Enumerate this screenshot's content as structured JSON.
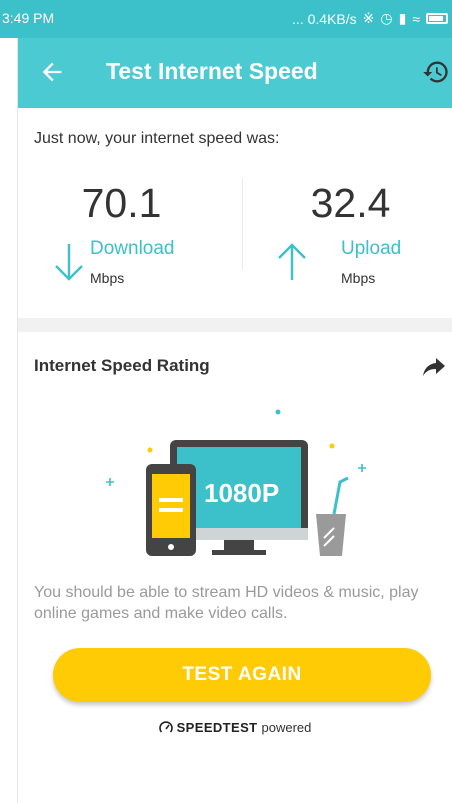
{
  "status_bar": {
    "time": "3:49 PM",
    "right_text": "... 0.4KB/s"
  },
  "app_bar": {
    "title": "Test Internet Speed",
    "back_icon": "arrow-left-icon",
    "history_icon": "history-icon"
  },
  "result": {
    "intro": "Just now, your internet speed was:",
    "download": {
      "value": "70.1",
      "label": "Download",
      "unit": "Mbps",
      "icon": "arrow-down-icon"
    },
    "upload": {
      "value": "32.4",
      "label": "Upload",
      "unit": "Mbps",
      "icon": "arrow-up-icon"
    }
  },
  "rating": {
    "title": "Internet Speed Rating",
    "share_icon": "share-icon",
    "badge": "1080P",
    "description": "You should be able to stream HD videos & music, play online games and make video calls."
  },
  "actions": {
    "test_again": "TEST AGAIN"
  },
  "powered": {
    "brand": "SPEEDTEST",
    "suffix": "powered"
  },
  "colors": {
    "header": "#4bcad2",
    "accent": "#3cc0c9",
    "button": "#ffcb05",
    "muted_text": "#9a9a9a"
  }
}
